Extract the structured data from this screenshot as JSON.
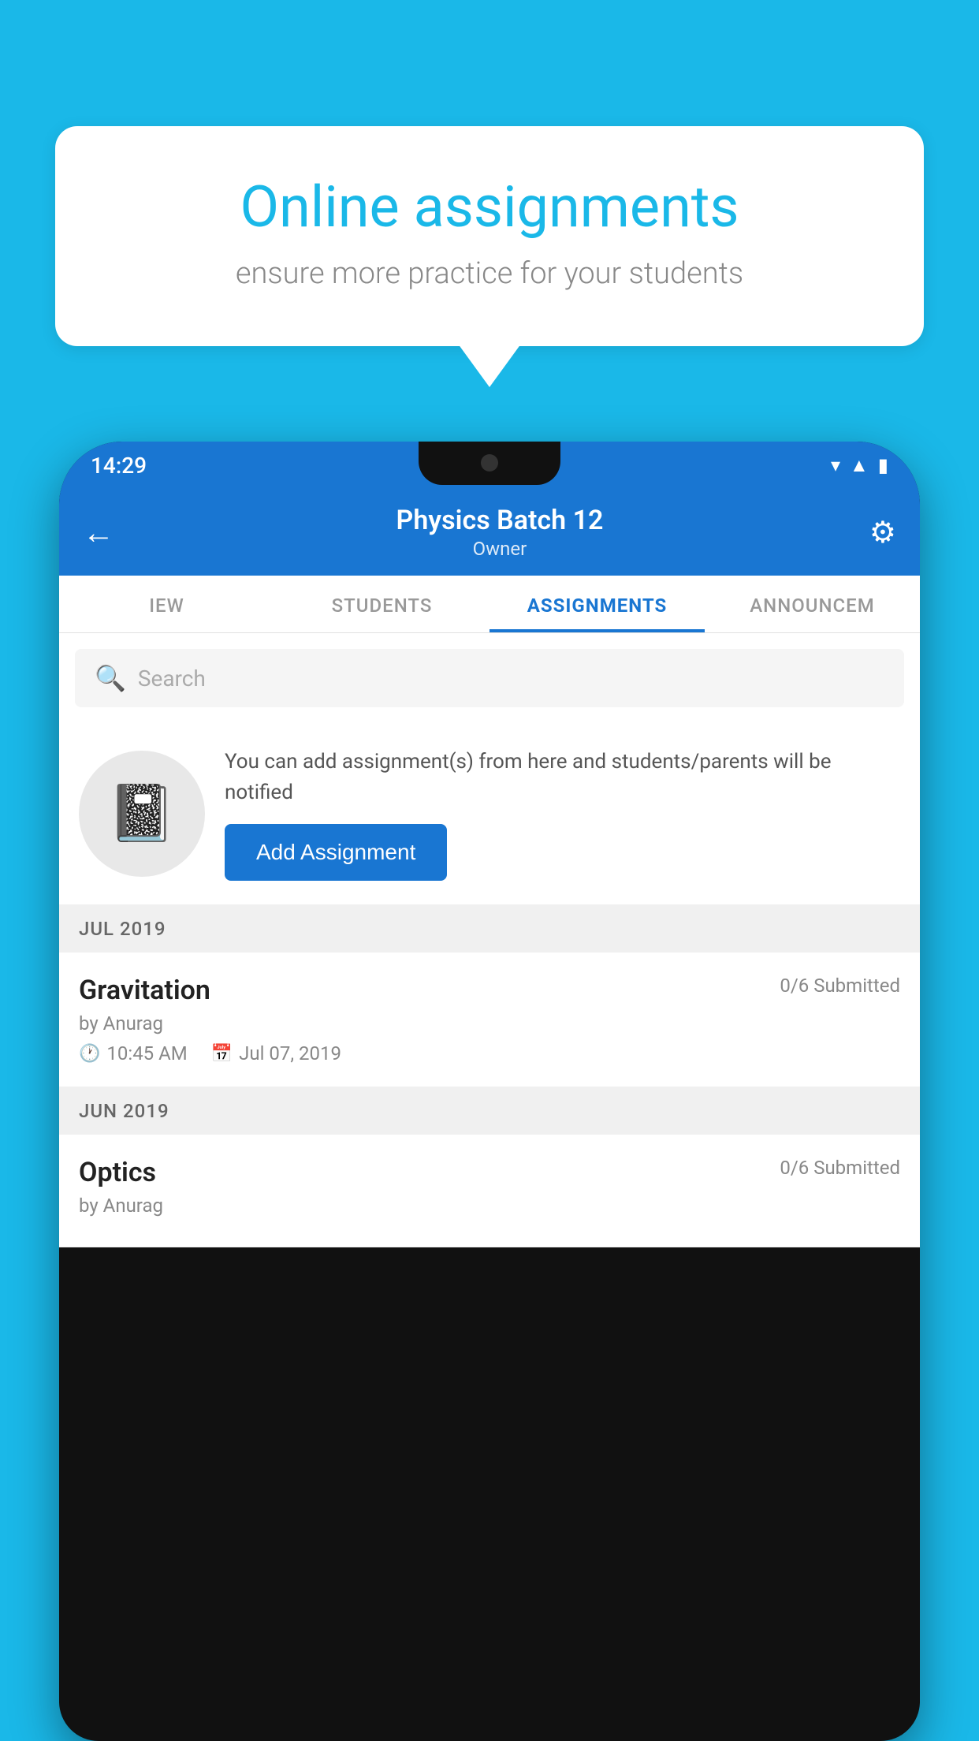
{
  "background_color": "#1ab8e8",
  "speech_bubble": {
    "title": "Online assignments",
    "subtitle": "ensure more practice for your students"
  },
  "phone": {
    "status_bar": {
      "time": "14:29",
      "icons": [
        "wifi",
        "signal",
        "battery"
      ]
    },
    "app_bar": {
      "title": "Physics Batch 12",
      "subtitle": "Owner",
      "back_label": "←",
      "settings_label": "⚙"
    },
    "tabs": [
      {
        "label": "IEW",
        "active": false
      },
      {
        "label": "STUDENTS",
        "active": false
      },
      {
        "label": "ASSIGNMENTS",
        "active": true
      },
      {
        "label": "ANNOUNCEM",
        "active": false
      }
    ],
    "search": {
      "placeholder": "Search"
    },
    "promo": {
      "description": "You can add assignment(s) from here and students/parents will be notified",
      "button_label": "Add Assignment"
    },
    "assignments": [
      {
        "month_label": "JUL 2019",
        "title": "Gravitation",
        "submitted": "0/6 Submitted",
        "by": "by Anurag",
        "time": "10:45 AM",
        "date": "Jul 07, 2019"
      },
      {
        "month_label": "JUN 2019",
        "title": "Optics",
        "submitted": "0/6 Submitted",
        "by": "by Anurag",
        "time": "",
        "date": ""
      }
    ]
  }
}
